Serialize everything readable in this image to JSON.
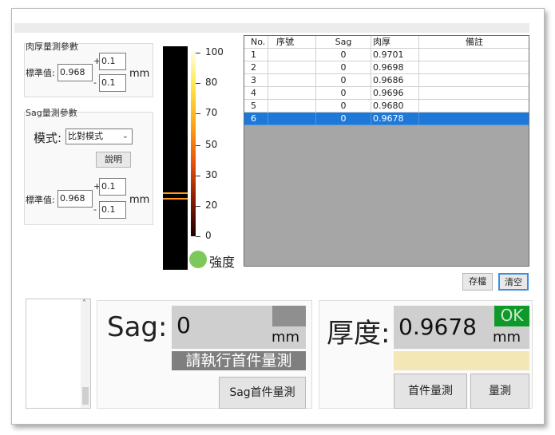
{
  "thickness_params": {
    "title": "肉厚量測參數",
    "std_label": "標準值:",
    "std_value": "0.968",
    "plus": "+",
    "minus": "-",
    "upper_tol": "0.1",
    "lower_tol": "0.1",
    "unit": "mm"
  },
  "sag_params": {
    "title": "Sag量測參數",
    "mode_label": "模式:",
    "mode_value": "比對模式",
    "help_button": "說明",
    "std_label": "標準值:",
    "std_value": "0.968",
    "plus": "+",
    "minus": "-",
    "upper_tol": "0.1",
    "lower_tol": "0.1",
    "unit": "mm"
  },
  "intensity": {
    "ticks": [
      "100",
      "80",
      "70",
      "50",
      "30",
      "20",
      "0"
    ],
    "label": "強度",
    "led_color": "#7cc85a"
  },
  "table": {
    "headers": [
      "No.",
      "序號",
      "Sag",
      "肉厚",
      "備註"
    ],
    "rows": [
      [
        "1",
        "",
        "0",
        "0.9701",
        ""
      ],
      [
        "2",
        "",
        "0",
        "0.9698",
        ""
      ],
      [
        "3",
        "",
        "0",
        "0.9686",
        ""
      ],
      [
        "4",
        "",
        "0",
        "0.9696",
        ""
      ],
      [
        "5",
        "",
        "0",
        "0.9680",
        ""
      ],
      [
        "6",
        "",
        "0",
        "0.9678",
        ""
      ]
    ],
    "selected_row": 6,
    "save_button": "存檔",
    "clear_button": "清空"
  },
  "sag_panel": {
    "label": "Sag:",
    "value": "0",
    "unit": "mm",
    "status": "請執行首件量測",
    "button": "Sag首件量測"
  },
  "thickness_panel": {
    "label": "厚度:",
    "value": "0.9678",
    "unit": "mm",
    "ok_badge": "OK",
    "first_button": "首件量測",
    "measure_button": "量測"
  },
  "colors": {
    "selected_row": "#1e78d7",
    "ok_green": "#0e9a2b",
    "status_gray": "#7f7f7f",
    "note_yellow": "#f3e7b5"
  }
}
